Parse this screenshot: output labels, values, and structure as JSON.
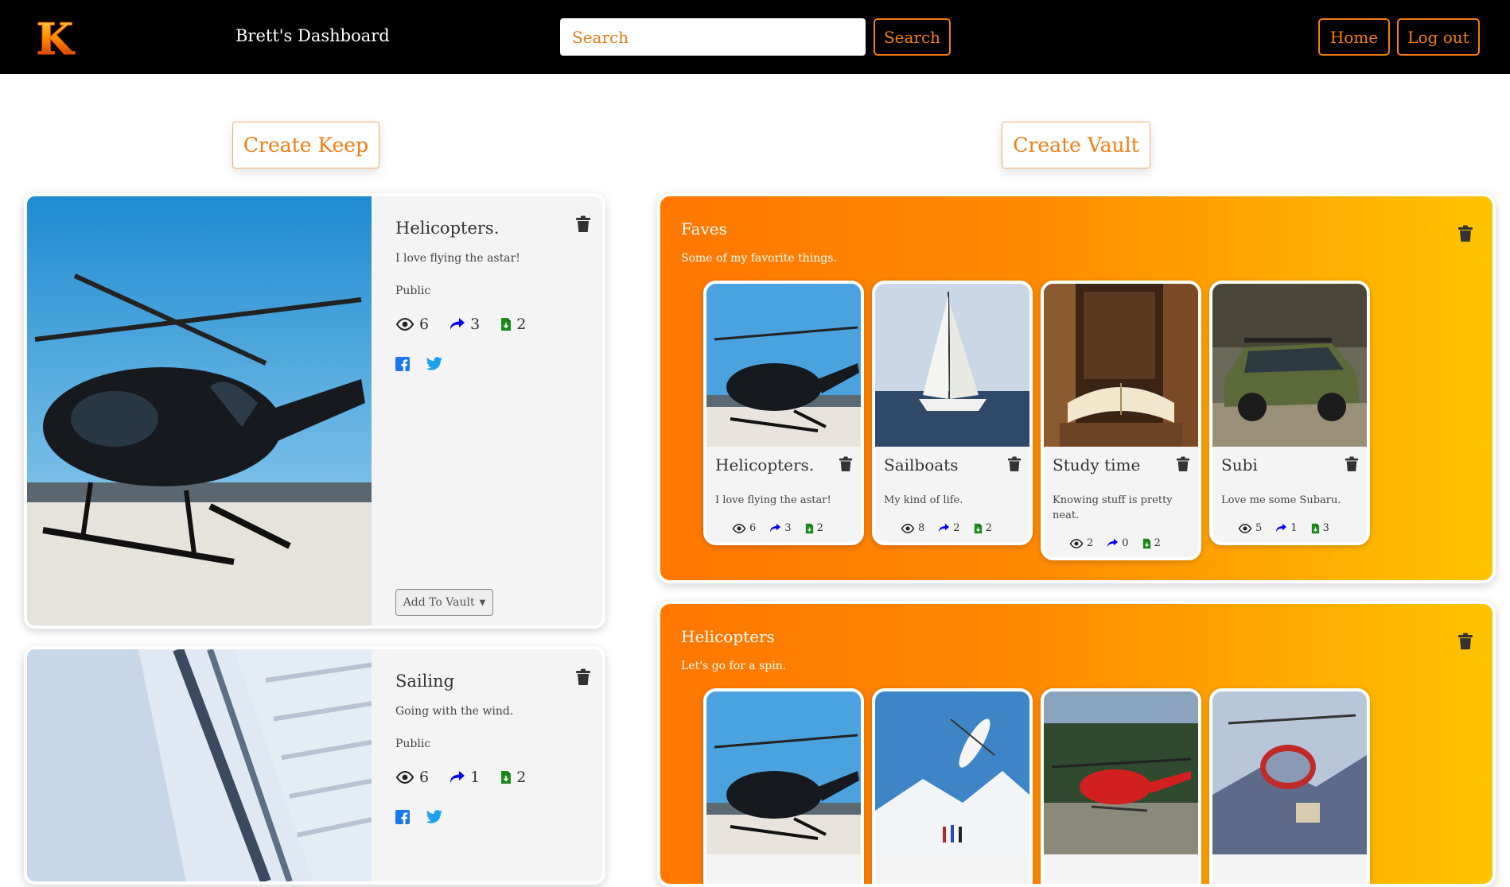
{
  "navbar": {
    "logo_letter": "K",
    "brand": "Brett's Dashboard",
    "search_placeholder": "Search",
    "search_button": "Search",
    "home_button": "Home",
    "logout_button": "Log out"
  },
  "actions": {
    "create_keep": "Create Keep",
    "create_vault": "Create Vault"
  },
  "keeps": [
    {
      "title": "Helicopters.",
      "description": "I love flying the astar!",
      "privacy": "Public",
      "views": "6",
      "shares": "3",
      "keeps": "2",
      "add_to_vault": "Add To Vault",
      "image": "black helicopter on helipad"
    },
    {
      "title": "Sailing",
      "description": "Going with the wind.",
      "privacy": "Public",
      "views": "6",
      "shares": "1",
      "keeps": "2",
      "image": "sailboat mast and rigging"
    }
  ],
  "vaults": [
    {
      "name": "Faves",
      "description": "Some of my favorite things.",
      "items": [
        {
          "title": "Helicopters.",
          "description": "I love flying the astar!",
          "views": "6",
          "shares": "3",
          "keeps": "2"
        },
        {
          "title": "Sailboats",
          "description": "My kind of life.",
          "views": "8",
          "shares": "2",
          "keeps": "2"
        },
        {
          "title": "Study time",
          "description": "Knowing stuff is pretty neat.",
          "views": "2",
          "shares": "0",
          "keeps": "2"
        },
        {
          "title": "Subi",
          "description": "Love me some Subaru.",
          "views": "5",
          "shares": "1",
          "keeps": "3"
        }
      ]
    },
    {
      "name": "Helicopters",
      "description": "Let's go for a spin.",
      "items": [
        {
          "image": "black helicopter"
        },
        {
          "image": "white helicopter over snow"
        },
        {
          "image": "red helicopter on pad"
        },
        {
          "image": "helicopter in snowy mountains"
        }
      ]
    }
  ],
  "colors": {
    "accent": "#f47c12",
    "navbar": "#000000",
    "vault_gradient_start": "#ff7700",
    "vault_gradient_end": "#ffc400",
    "share_icon": "#0000ee",
    "keep_icon": "#1a8a1a",
    "facebook": "#1877f2",
    "twitter": "#1da1f2"
  },
  "icons": [
    "eye-icon",
    "share-icon",
    "file-download-icon",
    "trash-icon",
    "facebook-icon",
    "twitter-icon",
    "caret-down-icon"
  ]
}
